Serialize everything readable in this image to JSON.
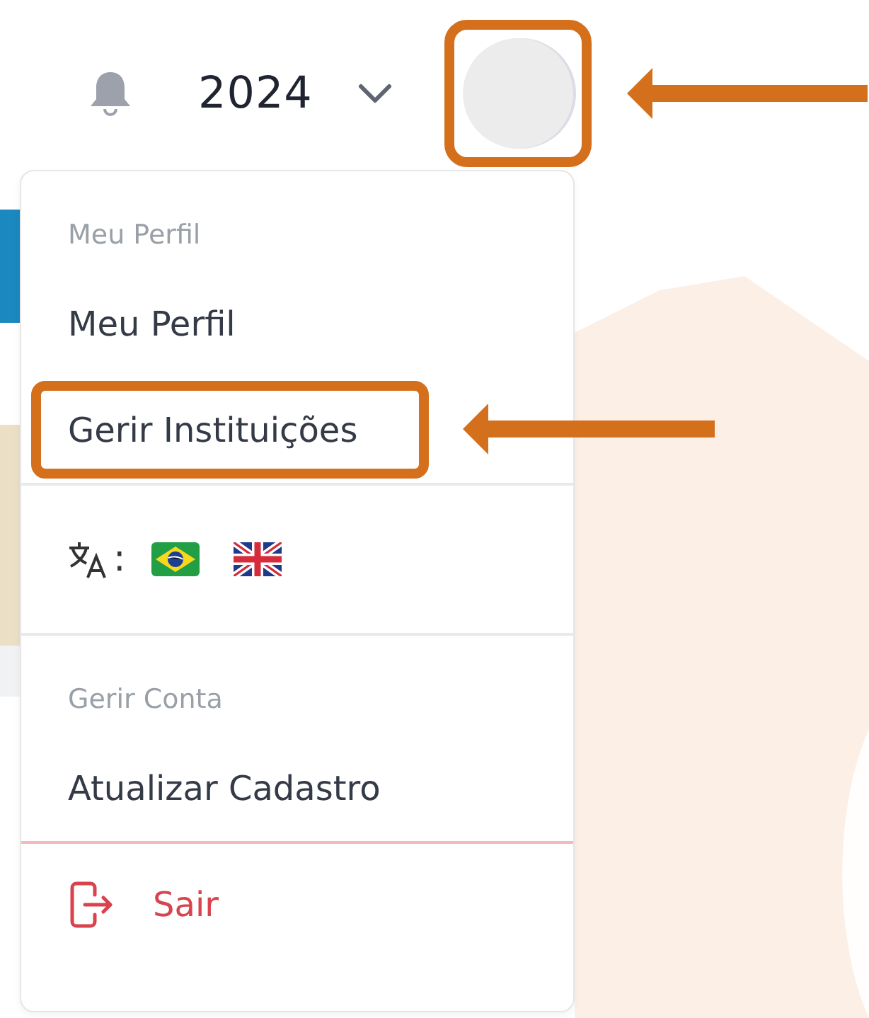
{
  "topbar": {
    "year": "2024",
    "avatar_highlighted": true
  },
  "menu": {
    "rows": [
      {
        "kind": "header",
        "label": "Meu Perfil"
      },
      {
        "kind": "link",
        "label": "Meu Perfil",
        "highlighted": false
      },
      {
        "kind": "link",
        "label": "Gerir Instituições",
        "highlighted": true
      },
      {
        "kind": "languages",
        "separator": ":"
      },
      {
        "kind": "header",
        "label": "Gerir Conta"
      },
      {
        "kind": "link",
        "label": "Atualizar Cadastro",
        "highlighted": false
      },
      {
        "kind": "logout",
        "label": "Sair"
      }
    ]
  }
}
